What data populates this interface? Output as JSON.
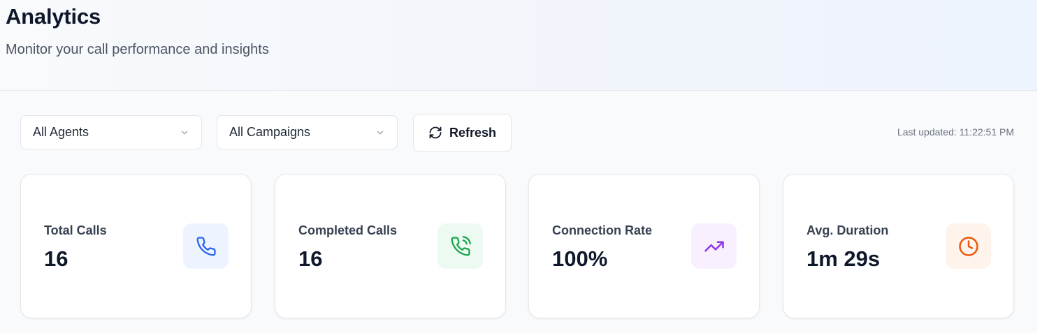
{
  "header": {
    "title": "Analytics",
    "subtitle": "Monitor your call performance and insights"
  },
  "filters": {
    "agents": {
      "selected": "All Agents"
    },
    "campaigns": {
      "selected": "All Campaigns"
    },
    "refresh_label": "Refresh",
    "last_updated": "Last updated: 11:22:51 PM"
  },
  "stats": [
    {
      "label": "Total Calls",
      "value": "16",
      "icon": "phone-icon",
      "color": "#2563eb",
      "bg": "#eef4ff"
    },
    {
      "label": "Completed Calls",
      "value": "16",
      "icon": "phone-call-icon",
      "color": "#16a34a",
      "bg": "#edfaf1"
    },
    {
      "label": "Connection Rate",
      "value": "100%",
      "icon": "trending-up-icon",
      "color": "#9333ea",
      "bg": "#f8f0ff"
    },
    {
      "label": "Avg. Duration",
      "value": "1m 29s",
      "icon": "clock-icon",
      "color": "#ea580c",
      "bg": "#fff4ec"
    }
  ]
}
